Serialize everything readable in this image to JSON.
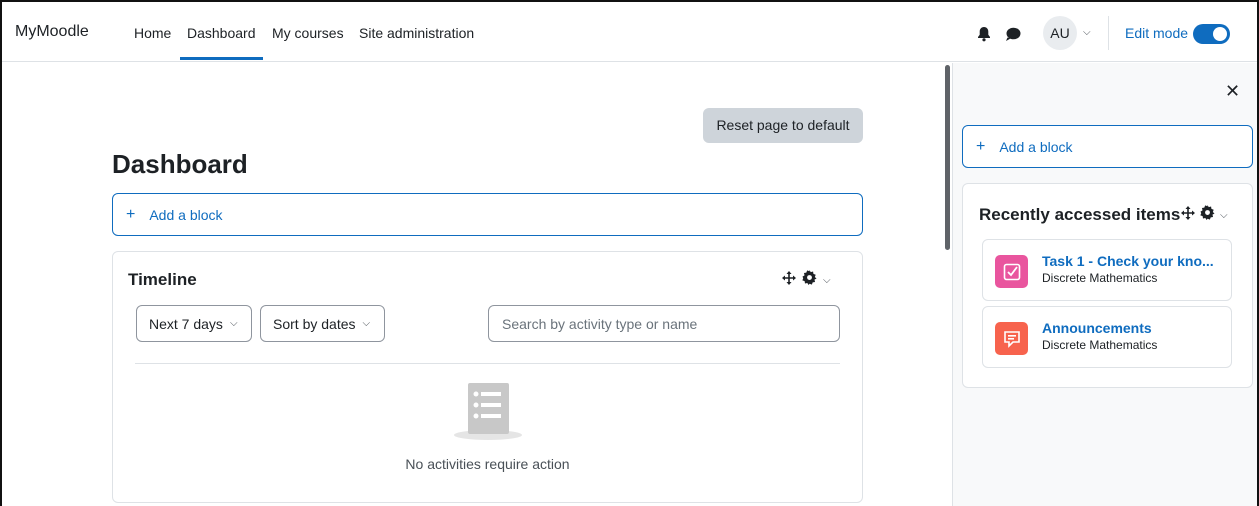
{
  "navbar": {
    "brand": "MyMoodle",
    "links": [
      {
        "label": "Home",
        "active": false
      },
      {
        "label": "Dashboard",
        "active": true
      },
      {
        "label": "My courses",
        "active": false
      },
      {
        "label": "Site administration",
        "active": false
      }
    ],
    "notifications_icon": "bell-icon",
    "messages_icon": "chat-icon",
    "user_initials": "AU",
    "edit_mode_label": "Edit mode",
    "edit_mode_on": true
  },
  "main": {
    "reset_label": "Reset page to default",
    "page_title": "Dashboard",
    "add_block_label": "Add a block",
    "timeline": {
      "title": "Timeline",
      "filter_label": "Next 7 days",
      "sort_label": "Sort by dates",
      "search_placeholder": "Search by activity type or name",
      "empty_text": "No activities require action"
    }
  },
  "drawer": {
    "close_icon": "close-icon",
    "add_block_label": "Add a block",
    "recent": {
      "title": "Recently accessed items",
      "items": [
        {
          "title": "Task 1 - Check your kno...",
          "course": "Discrete Mathematics",
          "icon": "assignment-icon",
          "color": "#e9559e"
        },
        {
          "title": "Announcements",
          "course": "Discrete Mathematics",
          "icon": "forum-icon",
          "color": "#f7634d"
        }
      ]
    }
  },
  "colors": {
    "accent": "#0f6cbf",
    "text": "#1d2125"
  }
}
